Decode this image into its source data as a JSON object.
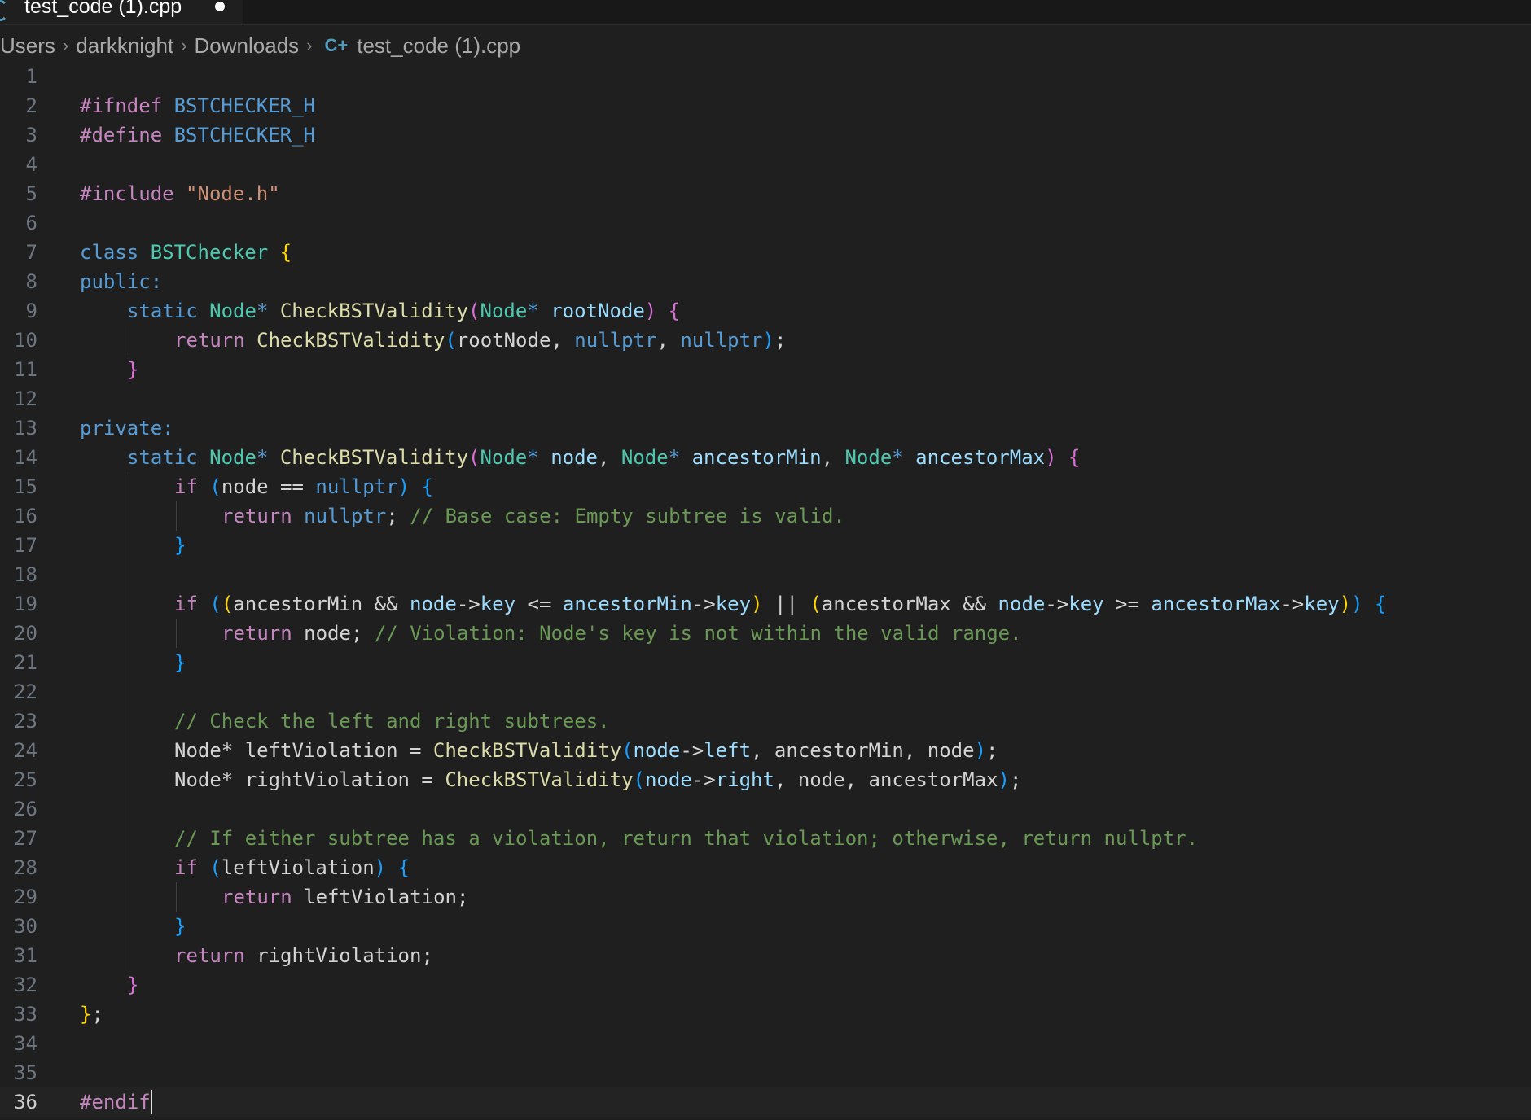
{
  "tab": {
    "label": "test_code (1).cpp"
  },
  "breadcrumb": {
    "items": [
      "Users",
      "darkknight",
      "Downloads"
    ],
    "file": "test_code (1).cpp"
  },
  "editor": {
    "current_line": 36,
    "lines": [
      {
        "n": 1,
        "indent": 0,
        "tokens": []
      },
      {
        "n": 2,
        "indent": 0,
        "tokens": [
          [
            "pp",
            "#ifndef "
          ],
          [
            "mac",
            "BSTCHECKER_H"
          ]
        ]
      },
      {
        "n": 3,
        "indent": 0,
        "tokens": [
          [
            "pp",
            "#define "
          ],
          [
            "mac",
            "BSTCHECKER_H"
          ]
        ]
      },
      {
        "n": 4,
        "indent": 0,
        "tokens": []
      },
      {
        "n": 5,
        "indent": 0,
        "tokens": [
          [
            "pp",
            "#include "
          ],
          [
            "str",
            "\"Node.h\""
          ]
        ]
      },
      {
        "n": 6,
        "indent": 0,
        "tokens": []
      },
      {
        "n": 7,
        "indent": 0,
        "tokens": [
          [
            "kw",
            "class "
          ],
          [
            "ty",
            "BSTChecker "
          ],
          [
            "p1",
            "{"
          ]
        ]
      },
      {
        "n": 8,
        "indent": 0,
        "tokens": [
          [
            "kw",
            "public:"
          ]
        ]
      },
      {
        "n": 9,
        "indent": 1,
        "tokens": [
          [
            "kw",
            "static "
          ],
          [
            "ty",
            "Node"
          ],
          [
            "kw",
            "* "
          ],
          [
            "fn",
            "CheckBSTValidity"
          ],
          [
            "p2",
            "("
          ],
          [
            "ty",
            "Node"
          ],
          [
            "kw",
            "* "
          ],
          [
            "var",
            "rootNode"
          ],
          [
            "p2",
            ")"
          ],
          [
            "tx",
            " "
          ],
          [
            "p2",
            "{"
          ]
        ]
      },
      {
        "n": 10,
        "indent": 2,
        "tokens": [
          [
            "ctl",
            "return "
          ],
          [
            "fn",
            "CheckBSTValidity"
          ],
          [
            "p3",
            "("
          ],
          [
            "tx",
            "rootNode, "
          ],
          [
            "kw",
            "nullptr"
          ],
          [
            "tx",
            ", "
          ],
          [
            "kw",
            "nullptr"
          ],
          [
            "p3",
            ")"
          ],
          [
            "tx",
            ";"
          ]
        ]
      },
      {
        "n": 11,
        "indent": 1,
        "tokens": [
          [
            "p2",
            "}"
          ]
        ]
      },
      {
        "n": 12,
        "indent": 0,
        "tokens": []
      },
      {
        "n": 13,
        "indent": 0,
        "tokens": [
          [
            "kw",
            "private:"
          ]
        ]
      },
      {
        "n": 14,
        "indent": 1,
        "tokens": [
          [
            "kw",
            "static "
          ],
          [
            "ty",
            "Node"
          ],
          [
            "kw",
            "* "
          ],
          [
            "fn",
            "CheckBSTValidity"
          ],
          [
            "p2",
            "("
          ],
          [
            "ty",
            "Node"
          ],
          [
            "kw",
            "* "
          ],
          [
            "var",
            "node"
          ],
          [
            "tx",
            ", "
          ],
          [
            "ty",
            "Node"
          ],
          [
            "kw",
            "* "
          ],
          [
            "var",
            "ancestorMin"
          ],
          [
            "tx",
            ", "
          ],
          [
            "ty",
            "Node"
          ],
          [
            "kw",
            "* "
          ],
          [
            "var",
            "ancestorMax"
          ],
          [
            "p2",
            ")"
          ],
          [
            "tx",
            " "
          ],
          [
            "p2",
            "{"
          ]
        ]
      },
      {
        "n": 15,
        "indent": 2,
        "tokens": [
          [
            "ctl",
            "if "
          ],
          [
            "p3",
            "("
          ],
          [
            "tx",
            "node == "
          ],
          [
            "kw",
            "nullptr"
          ],
          [
            "p3",
            ")"
          ],
          [
            "tx",
            " "
          ],
          [
            "p3",
            "{"
          ]
        ]
      },
      {
        "n": 16,
        "indent": 3,
        "tokens": [
          [
            "ctl",
            "return "
          ],
          [
            "kw",
            "nullptr"
          ],
          [
            "tx",
            "; "
          ],
          [
            "cm",
            "// Base case: Empty subtree is valid."
          ]
        ]
      },
      {
        "n": 17,
        "indent": 2,
        "tokens": [
          [
            "p3",
            "}"
          ]
        ]
      },
      {
        "n": 18,
        "indent": 0,
        "tokens": []
      },
      {
        "n": 19,
        "indent": 2,
        "tokens": [
          [
            "ctl",
            "if "
          ],
          [
            "p3",
            "("
          ],
          [
            "p1",
            "("
          ],
          [
            "tx",
            "ancestorMin && "
          ],
          [
            "var",
            "node"
          ],
          [
            "tx",
            "->"
          ],
          [
            "var",
            "key"
          ],
          [
            "tx",
            " <= "
          ],
          [
            "var",
            "ancestorMin"
          ],
          [
            "tx",
            "->"
          ],
          [
            "var",
            "key"
          ],
          [
            "p1",
            ")"
          ],
          [
            "tx",
            " || "
          ],
          [
            "p1",
            "("
          ],
          [
            "tx",
            "ancestorMax && "
          ],
          [
            "var",
            "node"
          ],
          [
            "tx",
            "->"
          ],
          [
            "var",
            "key"
          ],
          [
            "tx",
            " >= "
          ],
          [
            "var",
            "ancestorMax"
          ],
          [
            "tx",
            "->"
          ],
          [
            "var",
            "key"
          ],
          [
            "p1",
            ")"
          ],
          [
            "p3",
            ")"
          ],
          [
            "tx",
            " "
          ],
          [
            "p3",
            "{"
          ]
        ]
      },
      {
        "n": 20,
        "indent": 3,
        "tokens": [
          [
            "ctl",
            "return "
          ],
          [
            "tx",
            "node; "
          ],
          [
            "cm",
            "// Violation: Node's key is not within the valid range."
          ]
        ]
      },
      {
        "n": 21,
        "indent": 2,
        "tokens": [
          [
            "p3",
            "}"
          ]
        ]
      },
      {
        "n": 22,
        "indent": 0,
        "tokens": []
      },
      {
        "n": 23,
        "indent": 2,
        "tokens": [
          [
            "cm",
            "// Check the left and right subtrees."
          ]
        ]
      },
      {
        "n": 24,
        "indent": 2,
        "tokens": [
          [
            "tx",
            "Node* leftViolation = "
          ],
          [
            "fn",
            "CheckBSTValidity"
          ],
          [
            "p3",
            "("
          ],
          [
            "var",
            "node"
          ],
          [
            "tx",
            "->"
          ],
          [
            "var",
            "left"
          ],
          [
            "tx",
            ", ancestorMin, node"
          ],
          [
            "p3",
            ")"
          ],
          [
            "tx",
            ";"
          ]
        ]
      },
      {
        "n": 25,
        "indent": 2,
        "tokens": [
          [
            "tx",
            "Node* rightViolation = "
          ],
          [
            "fn",
            "CheckBSTValidity"
          ],
          [
            "p3",
            "("
          ],
          [
            "var",
            "node"
          ],
          [
            "tx",
            "->"
          ],
          [
            "var",
            "right"
          ],
          [
            "tx",
            ", node, ancestorMax"
          ],
          [
            "p3",
            ")"
          ],
          [
            "tx",
            ";"
          ]
        ]
      },
      {
        "n": 26,
        "indent": 0,
        "tokens": []
      },
      {
        "n": 27,
        "indent": 2,
        "tokens": [
          [
            "cm",
            "// If either subtree has a violation, return that violation; otherwise, return nullptr."
          ]
        ]
      },
      {
        "n": 28,
        "indent": 2,
        "tokens": [
          [
            "ctl",
            "if "
          ],
          [
            "p3",
            "("
          ],
          [
            "tx",
            "leftViolation"
          ],
          [
            "p3",
            ")"
          ],
          [
            "tx",
            " "
          ],
          [
            "p3",
            "{"
          ]
        ]
      },
      {
        "n": 29,
        "indent": 3,
        "tokens": [
          [
            "ctl",
            "return "
          ],
          [
            "tx",
            "leftViolation;"
          ]
        ]
      },
      {
        "n": 30,
        "indent": 2,
        "tokens": [
          [
            "p3",
            "}"
          ]
        ]
      },
      {
        "n": 31,
        "indent": 2,
        "tokens": [
          [
            "ctl",
            "return "
          ],
          [
            "tx",
            "rightViolation;"
          ]
        ]
      },
      {
        "n": 32,
        "indent": 1,
        "tokens": [
          [
            "p2",
            "}"
          ]
        ]
      },
      {
        "n": 33,
        "indent": 0,
        "tokens": [
          [
            "p1",
            "}"
          ],
          [
            "tx",
            ";"
          ]
        ]
      },
      {
        "n": 34,
        "indent": 0,
        "tokens": []
      },
      {
        "n": 35,
        "indent": 0,
        "tokens": []
      },
      {
        "n": 36,
        "indent": 0,
        "tokens": [
          [
            "pp",
            "#endif"
          ]
        ]
      }
    ]
  }
}
